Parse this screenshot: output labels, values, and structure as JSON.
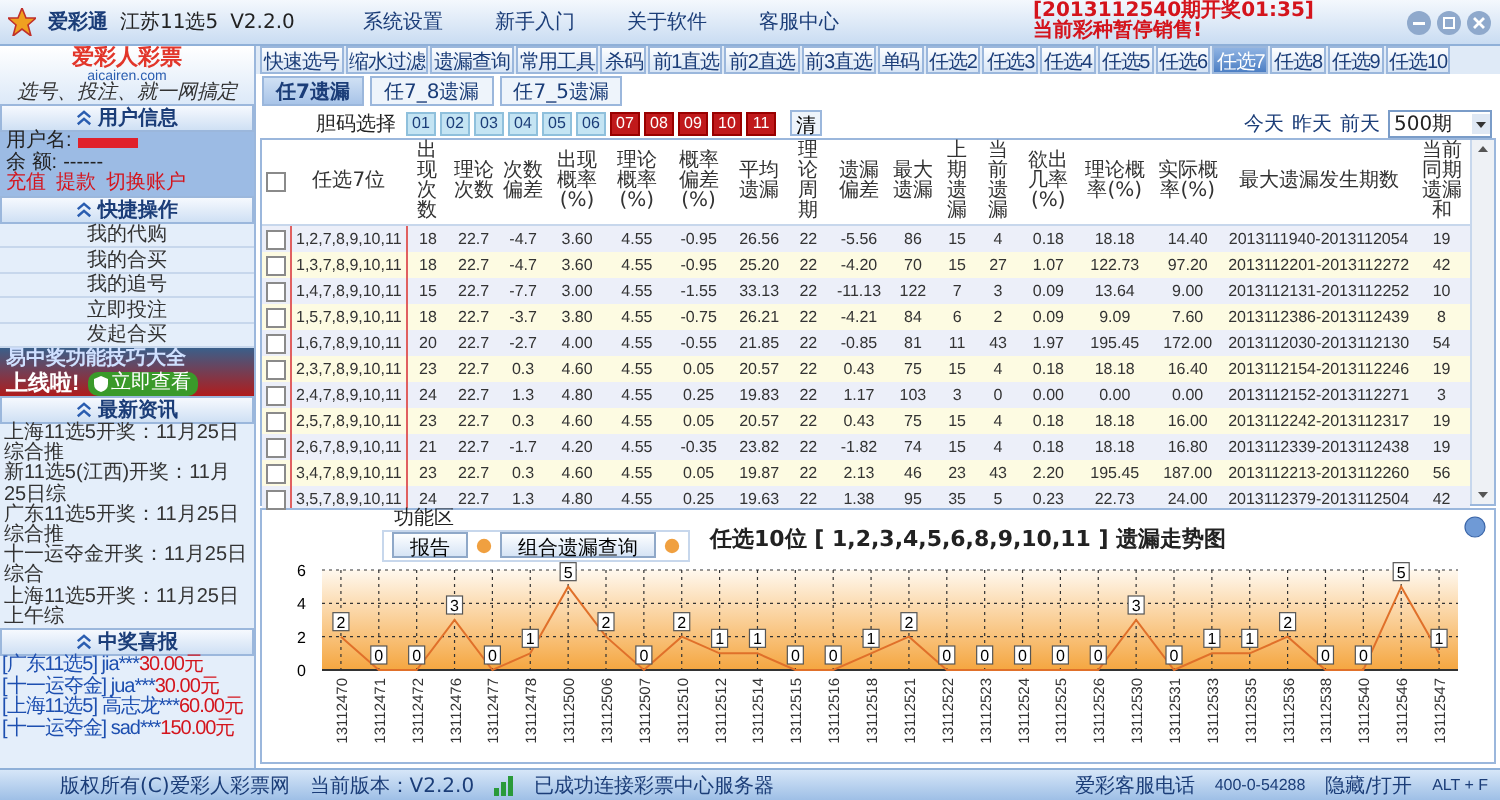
{
  "title_bar": {
    "app_name": "爱彩通",
    "lottery": "江苏11选5",
    "version": "V2.2.0",
    "menu": [
      "系统设置",
      "新手入门",
      "关于软件",
      "客服中心"
    ],
    "notice": [
      "[2013112540期开奖01:35]",
      "当前彩种暂停销售!"
    ]
  },
  "sidebar": {
    "logo": {
      "name": "爱彩人彩票",
      "domain": "aicairen.com",
      "slogan": "选号、投注、就一网搞定"
    },
    "user": {
      "title": "用户信息",
      "username_label": "用户名:",
      "balance_label": "余  额:",
      "balance": "------",
      "links": [
        "充值",
        "提款",
        "切换账户"
      ]
    },
    "quick": {
      "title": "快捷操作",
      "items": [
        "我的代购",
        "我的合买",
        "我的追号",
        "立即投注",
        "发起合买"
      ]
    },
    "ad": {
      "headline": "易中奖功能技巧大全",
      "subline": "上线啦!",
      "button": "立即查看"
    },
    "news": {
      "title": "最新资讯",
      "items": [
        "上海11选5开奖：11月25日综合推",
        "新11选5(江西)开奖：11月25日综",
        "广东11选5开奖：11月25日综合推",
        "十一运夺金开奖：11月25日综合",
        "上海11选5开奖：11月25日上午综"
      ]
    },
    "prizes": {
      "title": "中奖喜报",
      "items": [
        {
          "lottery": "[广东11选5]",
          "user": "jia***",
          "amount": "30.00元"
        },
        {
          "lottery": "[十一运夺金]",
          "user": "jua***",
          "amount": "30.00元"
        },
        {
          "lottery": "[上海11选5]",
          "user": "高志龙***",
          "amount": "60.00元"
        },
        {
          "lottery": "[十一运夺金]",
          "user": "sad***",
          "amount": "150.00元"
        }
      ]
    }
  },
  "main": {
    "tools": [
      "快速选号",
      "缩水过滤",
      "遗漏查询",
      "常用工具"
    ],
    "play_tabs": [
      {
        "label": "杀码",
        "selected": false
      },
      {
        "label": "前1直选",
        "selected": false
      },
      {
        "label": "前2直选",
        "selected": false
      },
      {
        "label": "前3直选",
        "selected": false
      },
      {
        "label": "单码",
        "selected": false
      },
      {
        "label": "任选2",
        "selected": false
      },
      {
        "label": "任选3",
        "selected": false
      },
      {
        "label": "任选4",
        "selected": false
      },
      {
        "label": "任选5",
        "selected": false
      },
      {
        "label": "任选6",
        "selected": false
      },
      {
        "label": "任选7",
        "selected": true
      },
      {
        "label": "任选8",
        "selected": false
      },
      {
        "label": "任选9",
        "selected": false
      },
      {
        "label": "任选10",
        "selected": false
      }
    ],
    "sub_tabs": [
      {
        "label": "任7遗漏",
        "selected": true
      },
      {
        "label": "任7_8遗漏",
        "selected": false
      },
      {
        "label": "任7_5遗漏",
        "selected": false
      }
    ],
    "filter": {
      "label": "胆码选择",
      "numbers": [
        {
          "label": "01",
          "selected": false
        },
        {
          "label": "02",
          "selected": false
        },
        {
          "label": "03",
          "selected": false
        },
        {
          "label": "04",
          "selected": false
        },
        {
          "label": "05",
          "selected": false
        },
        {
          "label": "06",
          "selected": false
        },
        {
          "label": "07",
          "selected": true
        },
        {
          "label": "08",
          "selected": true
        },
        {
          "label": "09",
          "selected": true
        },
        {
          "label": "10",
          "selected": true
        },
        {
          "label": "11",
          "selected": true
        }
      ],
      "clear": "清",
      "quick_days": [
        "今天",
        "昨天",
        "前天"
      ],
      "period_select": "500期"
    },
    "table": {
      "header_checked": false,
      "columns": [
        "任选7位",
        "出现次数",
        "理论次数",
        "次数偏差",
        "出现概率(%)",
        "理论概率(%)",
        "概率偏差(%)",
        "平均遗漏",
        "理论周期",
        "遗漏偏差",
        "最大遗漏",
        "上期遗漏",
        "当前遗漏",
        "欲出几率(%)",
        "理论概率(%)",
        "实际概率(%)",
        "最大遗漏发生期数",
        "当前同期遗漏和"
      ],
      "rows": [
        {
          "checked": false,
          "cells": [
            "1,2,7,8,9,10,11",
            "18",
            "22.7",
            "-4.7",
            "3.60",
            "4.55",
            "-0.95",
            "26.56",
            "22",
            "-5.56",
            "86",
            "15",
            "4",
            "0.18",
            "18.18",
            "14.40",
            "2013111940-2013112054",
            "19"
          ]
        },
        {
          "checked": false,
          "cells": [
            "1,3,7,8,9,10,11",
            "18",
            "22.7",
            "-4.7",
            "3.60",
            "4.55",
            "-0.95",
            "25.20",
            "22",
            "-4.20",
            "70",
            "15",
            "27",
            "1.07",
            "122.73",
            "97.20",
            "2013112201-2013112272",
            "42"
          ]
        },
        {
          "checked": false,
          "cells": [
            "1,4,7,8,9,10,11",
            "15",
            "22.7",
            "-7.7",
            "3.00",
            "4.55",
            "-1.55",
            "33.13",
            "22",
            "-11.13",
            "122",
            "7",
            "3",
            "0.09",
            "13.64",
            "9.00",
            "2013112131-2013112252",
            "10"
          ]
        },
        {
          "checked": false,
          "cells": [
            "1,5,7,8,9,10,11",
            "18",
            "22.7",
            "-3.7",
            "3.80",
            "4.55",
            "-0.75",
            "26.21",
            "22",
            "-4.21",
            "84",
            "6",
            "2",
            "0.09",
            "9.09",
            "7.60",
            "2013112386-2013112439",
            "8"
          ]
        },
        {
          "checked": false,
          "cells": [
            "1,6,7,8,9,10,11",
            "20",
            "22.7",
            "-2.7",
            "4.00",
            "4.55",
            "-0.55",
            "21.85",
            "22",
            "-0.85",
            "81",
            "11",
            "43",
            "1.97",
            "195.45",
            "172.00",
            "2013112030-2013112130",
            "54"
          ]
        },
        {
          "checked": false,
          "cells": [
            "2,3,7,8,9,10,11",
            "23",
            "22.7",
            "0.3",
            "4.60",
            "4.55",
            "0.05",
            "20.57",
            "22",
            "0.43",
            "75",
            "15",
            "4",
            "0.18",
            "18.18",
            "16.40",
            "2013112154-2013112246",
            "19"
          ]
        },
        {
          "checked": false,
          "cells": [
            "2,4,7,8,9,10,11",
            "24",
            "22.7",
            "1.3",
            "4.80",
            "4.55",
            "0.25",
            "19.83",
            "22",
            "1.17",
            "103",
            "3",
            "0",
            "0.00",
            "0.00",
            "0.00",
            "2013112152-2013112271",
            "3"
          ]
        },
        {
          "checked": false,
          "cells": [
            "2,5,7,8,9,10,11",
            "23",
            "22.7",
            "0.3",
            "4.60",
            "4.55",
            "0.05",
            "20.57",
            "22",
            "0.43",
            "75",
            "15",
            "4",
            "0.18",
            "18.18",
            "16.00",
            "2013112242-2013112317",
            "19"
          ]
        },
        {
          "checked": false,
          "cells": [
            "2,6,7,8,9,10,11",
            "21",
            "22.7",
            "-1.7",
            "4.20",
            "4.55",
            "-0.35",
            "23.82",
            "22",
            "-1.82",
            "74",
            "15",
            "4",
            "0.18",
            "18.18",
            "16.80",
            "2013112339-2013112438",
            "19"
          ]
        },
        {
          "checked": false,
          "cells": [
            "3,4,7,8,9,10,11",
            "23",
            "22.7",
            "0.3",
            "4.60",
            "4.55",
            "0.05",
            "19.87",
            "22",
            "2.13",
            "46",
            "23",
            "43",
            "2.20",
            "195.45",
            "187.00",
            "2013112213-2013112260",
            "56"
          ]
        },
        {
          "checked": false,
          "cells": [
            "3,5,7,8,9,10,11",
            "24",
            "22.7",
            "1.3",
            "4.80",
            "4.55",
            "0.25",
            "19.63",
            "22",
            "1.38",
            "95",
            "35",
            "5",
            "0.23",
            "22.73",
            "24.00",
            "2013112379-2013112504",
            "42"
          ]
        }
      ]
    },
    "chart_panel": {
      "function_area": {
        "title": "功能区",
        "buttons": [
          "报告",
          "组合遗漏查询"
        ]
      },
      "chart_data": {
        "type": "line",
        "title": "任选10位 [ 1,2,3,4,5,6,8,9,10,11 ] 遗漏走势图",
        "categories": [
          "13112470",
          "13112471",
          "13112472",
          "13112476",
          "13112477",
          "13112478",
          "13112500",
          "13112506",
          "13112507",
          "13112510",
          "13112512",
          "13112514",
          "13112515",
          "13112516",
          "13112518",
          "13112521",
          "13112522",
          "13112523",
          "13112524",
          "13112525",
          "13112526",
          "13112530",
          "13112531",
          "13112533",
          "13112535",
          "13112536",
          "13112538",
          "13112540",
          "13112546",
          "13112547"
        ],
        "series": [
          {
            "color": "#e0702a",
            "values": [
              2,
              0,
              0,
              3,
              0,
              1,
              5,
              2,
              0,
              2,
              1,
              1,
              0,
              0,
              1,
              2,
              0,
              0,
              0,
              0,
              0,
              3,
              0,
              1,
              1,
              2,
              0,
              0,
              5,
              1
            ]
          }
        ],
        "ylim": [
          0,
          6
        ],
        "yticks": [
          0,
          2,
          4,
          6
        ],
        "grid": true,
        "data_labels": true
      }
    }
  },
  "status_bar": {
    "copyright": "版权所有(C)爱彩人彩票网",
    "version": "当前版本：V2.2.0",
    "connection": "已成功连接彩票中心服务器",
    "hotline_label": "爱彩客服电话",
    "hotline": "400-0-54288",
    "toggle": "隐藏/打开",
    "shortcut": "ALT + F"
  }
}
